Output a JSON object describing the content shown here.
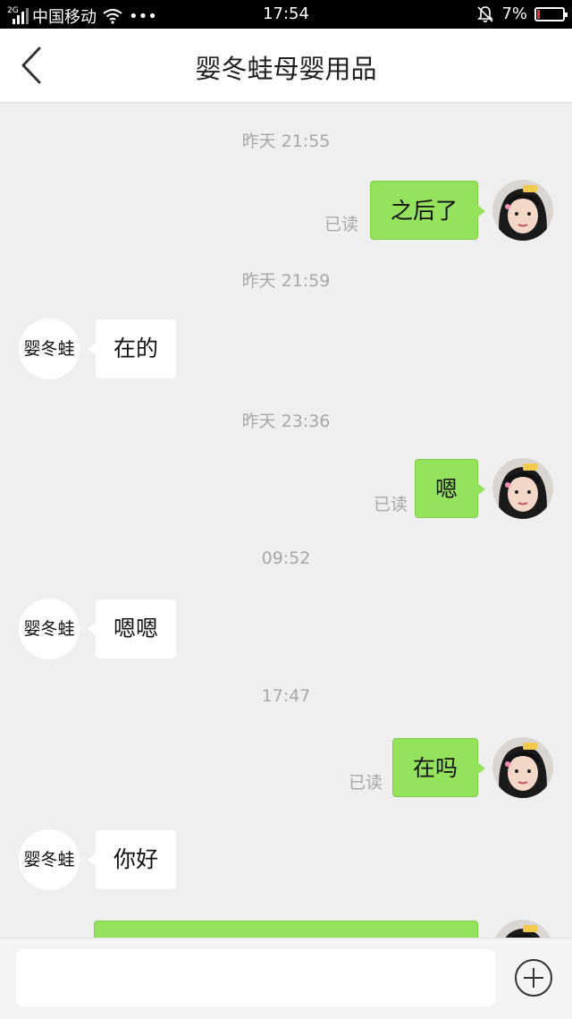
{
  "statusbar": {
    "network_small": "2G",
    "carrier": "中国移动",
    "more": "•••",
    "time": "17:54",
    "battery": "7%"
  },
  "header": {
    "title": "婴冬蛙母婴用品"
  },
  "contact_name": "婴冬蛙",
  "messages": [
    {
      "timestamp": "昨天 21:55",
      "sender": "me",
      "text": "之后了",
      "read": "已读"
    },
    {
      "timestamp": "昨天 21:59",
      "sender": "them",
      "text": "在的"
    },
    {
      "timestamp": "昨天 23:36",
      "sender": "me",
      "text": "嗯",
      "read": "已读"
    },
    {
      "timestamp": "09:52",
      "sender": "them",
      "text": "嗯嗯"
    },
    {
      "timestamp": "17:47",
      "sender": "me",
      "text": "在吗",
      "read": "已读"
    },
    {
      "sender": "them",
      "text": "你好"
    }
  ],
  "input": {
    "placeholder": ""
  },
  "colors": {
    "my_bubble": "#95e25c",
    "their_bubble": "#ffffff",
    "background": "#efefef"
  }
}
